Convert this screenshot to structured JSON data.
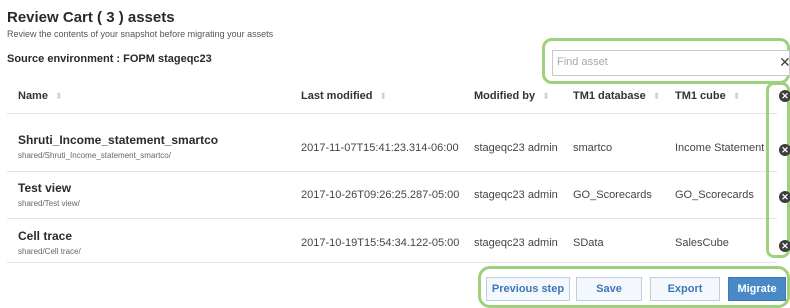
{
  "header": {
    "title": "Review Cart ( 3 ) assets",
    "subtitle": "Review the contents of your snapshot before migrating your assets",
    "source_environment": "Source environment : FOPM stageqc23"
  },
  "search": {
    "placeholder": "Find asset",
    "value": "",
    "clear_glyph": "✕"
  },
  "table": {
    "columns": [
      "Name",
      "Last modified",
      "Modified by",
      "TM1 database",
      "TM1 cube"
    ],
    "rows": [
      {
        "name": "Shruti_Income_statement_smartco",
        "path": "shared/Shruti_Income_statement_smartco/",
        "last_modified": "2017-11-07T15:41:23.314-06:00",
        "modified_by": "stageqc23 admin",
        "tm1_database": "smartco",
        "tm1_cube": "Income Statement"
      },
      {
        "name": "Test view",
        "path": "shared/Test view/",
        "last_modified": "2017-10-26T09:26:25.287-05:00",
        "modified_by": "stageqc23 admin",
        "tm1_database": "GO_Scorecards",
        "tm1_cube": "GO_Scorecards"
      },
      {
        "name": "Cell trace",
        "path": "shared/Cell trace/",
        "last_modified": "2017-10-19T15:54:34.122-05:00",
        "modified_by": "stageqc23 admin",
        "tm1_database": "SData",
        "tm1_cube": "SalesCube"
      }
    ],
    "remove_all_icon": "remove-circle-icon",
    "row_remove_icon": "remove-circle-icon"
  },
  "actions": {
    "previous_label": "Previous step",
    "save_label": "Save",
    "export_label": "Export",
    "migrate_label": "Migrate"
  },
  "colors": {
    "highlight": "#9fd07e",
    "primary": "#4a89c8",
    "link": "#3a78b8"
  }
}
